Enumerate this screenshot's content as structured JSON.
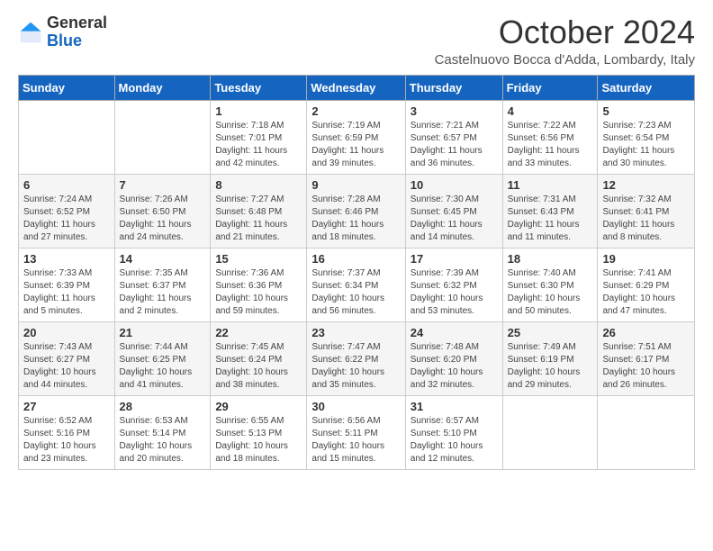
{
  "header": {
    "logo_general": "General",
    "logo_blue": "Blue",
    "month_title": "October 2024",
    "location": "Castelnuovo Bocca d'Adda, Lombardy, Italy"
  },
  "days_of_week": [
    "Sunday",
    "Monday",
    "Tuesday",
    "Wednesday",
    "Thursday",
    "Friday",
    "Saturday"
  ],
  "weeks": [
    [
      {
        "day": "",
        "sunrise": "",
        "sunset": "",
        "daylight": ""
      },
      {
        "day": "",
        "sunrise": "",
        "sunset": "",
        "daylight": ""
      },
      {
        "day": "1",
        "sunrise": "Sunrise: 7:18 AM",
        "sunset": "Sunset: 7:01 PM",
        "daylight": "Daylight: 11 hours and 42 minutes."
      },
      {
        "day": "2",
        "sunrise": "Sunrise: 7:19 AM",
        "sunset": "Sunset: 6:59 PM",
        "daylight": "Daylight: 11 hours and 39 minutes."
      },
      {
        "day": "3",
        "sunrise": "Sunrise: 7:21 AM",
        "sunset": "Sunset: 6:57 PM",
        "daylight": "Daylight: 11 hours and 36 minutes."
      },
      {
        "day": "4",
        "sunrise": "Sunrise: 7:22 AM",
        "sunset": "Sunset: 6:56 PM",
        "daylight": "Daylight: 11 hours and 33 minutes."
      },
      {
        "day": "5",
        "sunrise": "Sunrise: 7:23 AM",
        "sunset": "Sunset: 6:54 PM",
        "daylight": "Daylight: 11 hours and 30 minutes."
      }
    ],
    [
      {
        "day": "6",
        "sunrise": "Sunrise: 7:24 AM",
        "sunset": "Sunset: 6:52 PM",
        "daylight": "Daylight: 11 hours and 27 minutes."
      },
      {
        "day": "7",
        "sunrise": "Sunrise: 7:26 AM",
        "sunset": "Sunset: 6:50 PM",
        "daylight": "Daylight: 11 hours and 24 minutes."
      },
      {
        "day": "8",
        "sunrise": "Sunrise: 7:27 AM",
        "sunset": "Sunset: 6:48 PM",
        "daylight": "Daylight: 11 hours and 21 minutes."
      },
      {
        "day": "9",
        "sunrise": "Sunrise: 7:28 AM",
        "sunset": "Sunset: 6:46 PM",
        "daylight": "Daylight: 11 hours and 18 minutes."
      },
      {
        "day": "10",
        "sunrise": "Sunrise: 7:30 AM",
        "sunset": "Sunset: 6:45 PM",
        "daylight": "Daylight: 11 hours and 14 minutes."
      },
      {
        "day": "11",
        "sunrise": "Sunrise: 7:31 AM",
        "sunset": "Sunset: 6:43 PM",
        "daylight": "Daylight: 11 hours and 11 minutes."
      },
      {
        "day": "12",
        "sunrise": "Sunrise: 7:32 AM",
        "sunset": "Sunset: 6:41 PM",
        "daylight": "Daylight: 11 hours and 8 minutes."
      }
    ],
    [
      {
        "day": "13",
        "sunrise": "Sunrise: 7:33 AM",
        "sunset": "Sunset: 6:39 PM",
        "daylight": "Daylight: 11 hours and 5 minutes."
      },
      {
        "day": "14",
        "sunrise": "Sunrise: 7:35 AM",
        "sunset": "Sunset: 6:37 PM",
        "daylight": "Daylight: 11 hours and 2 minutes."
      },
      {
        "day": "15",
        "sunrise": "Sunrise: 7:36 AM",
        "sunset": "Sunset: 6:36 PM",
        "daylight": "Daylight: 10 hours and 59 minutes."
      },
      {
        "day": "16",
        "sunrise": "Sunrise: 7:37 AM",
        "sunset": "Sunset: 6:34 PM",
        "daylight": "Daylight: 10 hours and 56 minutes."
      },
      {
        "day": "17",
        "sunrise": "Sunrise: 7:39 AM",
        "sunset": "Sunset: 6:32 PM",
        "daylight": "Daylight: 10 hours and 53 minutes."
      },
      {
        "day": "18",
        "sunrise": "Sunrise: 7:40 AM",
        "sunset": "Sunset: 6:30 PM",
        "daylight": "Daylight: 10 hours and 50 minutes."
      },
      {
        "day": "19",
        "sunrise": "Sunrise: 7:41 AM",
        "sunset": "Sunset: 6:29 PM",
        "daylight": "Daylight: 10 hours and 47 minutes."
      }
    ],
    [
      {
        "day": "20",
        "sunrise": "Sunrise: 7:43 AM",
        "sunset": "Sunset: 6:27 PM",
        "daylight": "Daylight: 10 hours and 44 minutes."
      },
      {
        "day": "21",
        "sunrise": "Sunrise: 7:44 AM",
        "sunset": "Sunset: 6:25 PM",
        "daylight": "Daylight: 10 hours and 41 minutes."
      },
      {
        "day": "22",
        "sunrise": "Sunrise: 7:45 AM",
        "sunset": "Sunset: 6:24 PM",
        "daylight": "Daylight: 10 hours and 38 minutes."
      },
      {
        "day": "23",
        "sunrise": "Sunrise: 7:47 AM",
        "sunset": "Sunset: 6:22 PM",
        "daylight": "Daylight: 10 hours and 35 minutes."
      },
      {
        "day": "24",
        "sunrise": "Sunrise: 7:48 AM",
        "sunset": "Sunset: 6:20 PM",
        "daylight": "Daylight: 10 hours and 32 minutes."
      },
      {
        "day": "25",
        "sunrise": "Sunrise: 7:49 AM",
        "sunset": "Sunset: 6:19 PM",
        "daylight": "Daylight: 10 hours and 29 minutes."
      },
      {
        "day": "26",
        "sunrise": "Sunrise: 7:51 AM",
        "sunset": "Sunset: 6:17 PM",
        "daylight": "Daylight: 10 hours and 26 minutes."
      }
    ],
    [
      {
        "day": "27",
        "sunrise": "Sunrise: 6:52 AM",
        "sunset": "Sunset: 5:16 PM",
        "daylight": "Daylight: 10 hours and 23 minutes."
      },
      {
        "day": "28",
        "sunrise": "Sunrise: 6:53 AM",
        "sunset": "Sunset: 5:14 PM",
        "daylight": "Daylight: 10 hours and 20 minutes."
      },
      {
        "day": "29",
        "sunrise": "Sunrise: 6:55 AM",
        "sunset": "Sunset: 5:13 PM",
        "daylight": "Daylight: 10 hours and 18 minutes."
      },
      {
        "day": "30",
        "sunrise": "Sunrise: 6:56 AM",
        "sunset": "Sunset: 5:11 PM",
        "daylight": "Daylight: 10 hours and 15 minutes."
      },
      {
        "day": "31",
        "sunrise": "Sunrise: 6:57 AM",
        "sunset": "Sunset: 5:10 PM",
        "daylight": "Daylight: 10 hours and 12 minutes."
      },
      {
        "day": "",
        "sunrise": "",
        "sunset": "",
        "daylight": ""
      },
      {
        "day": "",
        "sunrise": "",
        "sunset": "",
        "daylight": ""
      }
    ]
  ]
}
